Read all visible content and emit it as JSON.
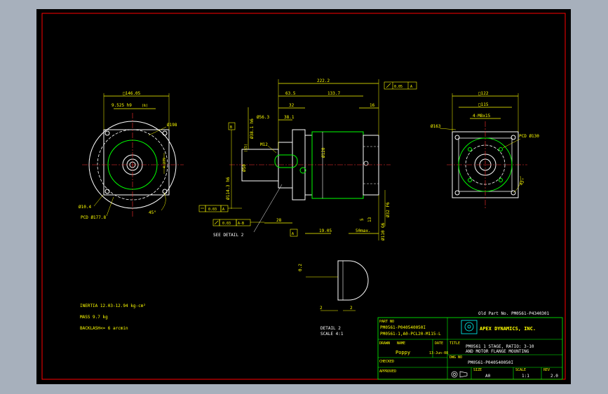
{
  "colors": {
    "background": "#000000",
    "outer_bg": "#a7b0bc",
    "border_red": "#ff0000",
    "line_white": "#ffffff",
    "dim_yellow": "#ffff00",
    "geom_green": "#00ff00",
    "center_red": "#ff3030",
    "cyan": "#00ffff"
  },
  "front_view": {
    "width_dim": "□146.05",
    "shaft_dim": "9.525 h9",
    "keyway_ref": "(‰)",
    "dia_198": "Ø198",
    "dim_279": "4.279",
    "dia_bolt": "Ø10.4",
    "pcd": "PCD Ø177.8",
    "angle": "45°"
  },
  "side_view": {
    "overall_len": "222.2",
    "len_635": "63.5",
    "len_1337": "133.7",
    "len_32": "32",
    "len_381": "38.1",
    "len_16": "16",
    "dia_563": "Ø56.3",
    "dia_381h6": "Ø38.1 h6",
    "dia_114": "Ø114.3 h6",
    "dia_50": "Ø50",
    "dia_120": "Ø120",
    "thread": "M12",
    "len_28": "28",
    "len_1905": "19.05",
    "len_50max": "50max.",
    "len_5": "5",
    "dia_32": "Ø32 F6",
    "dia_110": "Ø110 G6",
    "len_13": "13",
    "datum_a": "A",
    "datum_b": "B",
    "tol_parallel": "0.05",
    "tol_perp": "0.03",
    "tol_runout": "0.03",
    "tol_ab": "A-B",
    "see_detail": "SEE DETAIL 2",
    "dim_15": "(15)"
  },
  "end_view": {
    "square_122": "□122",
    "square_115": "□115",
    "bolts": "4-M8x15",
    "dia_163": "Ø163",
    "pcd": "PCD Ø130",
    "angle": "45°"
  },
  "detail": {
    "dim_02": "0.2",
    "dim_2a": "2",
    "dim_2b": "2",
    "title": "DETAIL 2",
    "scale": "SCALE 4:1"
  },
  "notes": {
    "inertia": "INERTIA 12.03-12.94 kg-cm²",
    "mass": "MASS 9.7 kg",
    "backlash": "BACKLASH<= 6 arcmin",
    "old_part": "Old Part No. PM0561-P4340301"
  },
  "title_block": {
    "part_no_label": "PART NO",
    "part_no_1": "PM0561-P040540050I",
    "part_no_2": "PM0561-1,A0-PCL20-M115-L",
    "company": "APEX DYNAMICS, INC.",
    "title_label": "TITLE",
    "title_1": "PM0561 1 STAGE, RATIO: 3-10",
    "title_2": "AND MOTOR FLANGE MOUNTING",
    "drawn_label": "DRAWN",
    "name_label": "NAME",
    "drawn_by": "Poppy",
    "date_label": "DATE",
    "date": "13-Jun-08",
    "dwg_no_label": "DWG NO",
    "dwg_no": "PM0561-P040540050I",
    "checked_label": "CHECKED",
    "approved_label": "APPROVED",
    "size_label": "SIZE",
    "size": "A0",
    "scale_label": "SCALE",
    "scale": "1:1",
    "rev_label": "REV",
    "rev": "2.0"
  }
}
